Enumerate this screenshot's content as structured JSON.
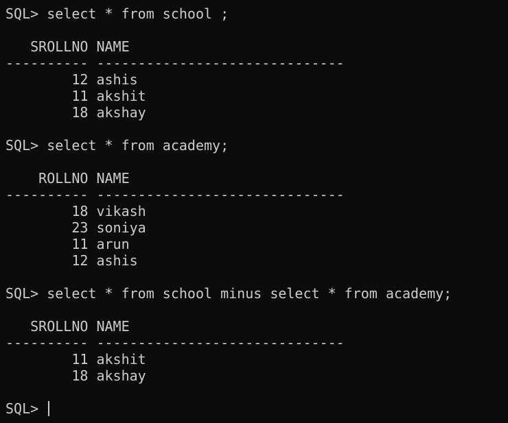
{
  "terminal": {
    "lines": [
      "SQL> select * from school ;",
      "",
      "   SROLLNO NAME",
      "---------- ------------------------------",
      "        12 ashis",
      "        11 akshit",
      "        18 akshay",
      "",
      "SQL> select * from academy;",
      "",
      "    ROLLNO NAME",
      "---------- ------------------------------",
      "        18 vikash",
      "        23 soniya",
      "        11 arun",
      "        12 ashis",
      "",
      "SQL> select * from school minus select * from academy;",
      "",
      "   SROLLNO NAME",
      "---------- ------------------------------",
      "        11 akshit",
      "        18 akshay",
      ""
    ],
    "prompt": "SQL> "
  },
  "colors": {
    "background": "#0c0c0c",
    "foreground": "#cccccc"
  }
}
